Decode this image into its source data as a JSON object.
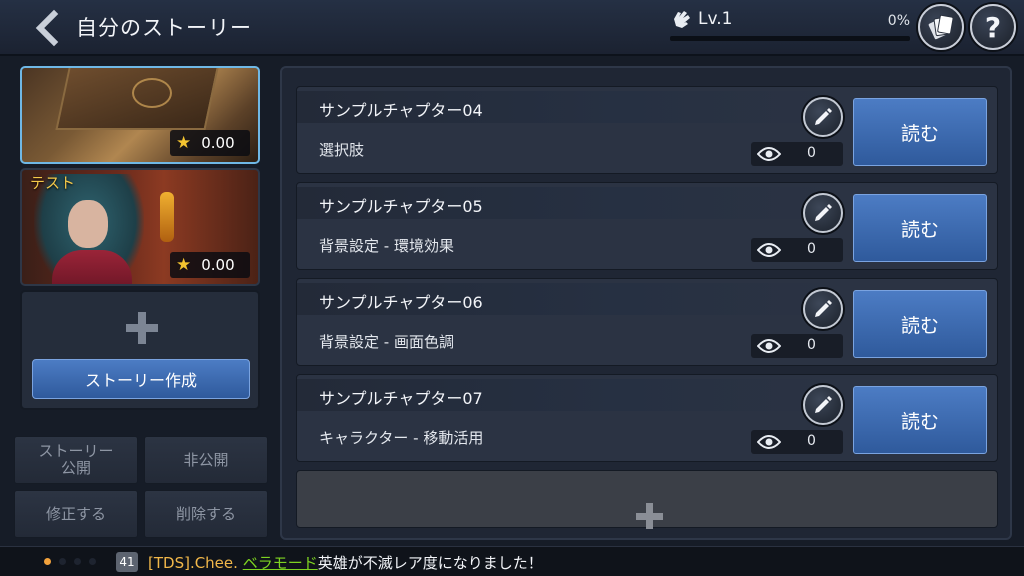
{
  "header": {
    "title": "自分のストーリー",
    "level_label": "Lv.1",
    "progress_text": "0%",
    "progress_fraction": 0
  },
  "stories": [
    {
      "label": "",
      "rating": "0.00",
      "selected": true
    },
    {
      "label": "テスト",
      "rating": "0.00",
      "selected": false
    }
  ],
  "create": {
    "button_label": "ストーリー作成"
  },
  "actions": {
    "publish_label": "ストーリー\n公開",
    "private_label": "非公開",
    "edit_label": "修正する",
    "delete_label": "削除する"
  },
  "chapters": [
    {
      "title": "サンプルチャプター04",
      "subtitle": "選択肢",
      "views": "0",
      "read_label": "読む"
    },
    {
      "title": "サンプルチャプター05",
      "subtitle": "背景設定 - 環境効果",
      "views": "0",
      "read_label": "読む"
    },
    {
      "title": "サンプルチャプター06",
      "subtitle": "背景設定 - 画面色調",
      "views": "0",
      "read_label": "読む"
    },
    {
      "title": "サンプルチャプター07",
      "subtitle": "キャラクター - 移動活用",
      "views": "0",
      "read_label": "読む"
    }
  ],
  "ticker": {
    "badge": "41",
    "user": "[TDS].Chee.",
    "hero": "ベラモード",
    "message": "英雄が不滅レア度になりました！",
    "page_count": 4,
    "active_page": 0
  },
  "colors": {
    "accent_blue": "#3f6db3",
    "gold": "#f4c430",
    "hero_green": "#7ed321",
    "user_orange": "#f2b84a"
  },
  "icons": {
    "back": "chevron-left-icon",
    "level": "hand-icon",
    "cards": "cards-icon",
    "help": "question-icon",
    "edit": "pencil-icon",
    "views": "eye-icon",
    "rating": "star-icon",
    "add": "plus-icon"
  }
}
